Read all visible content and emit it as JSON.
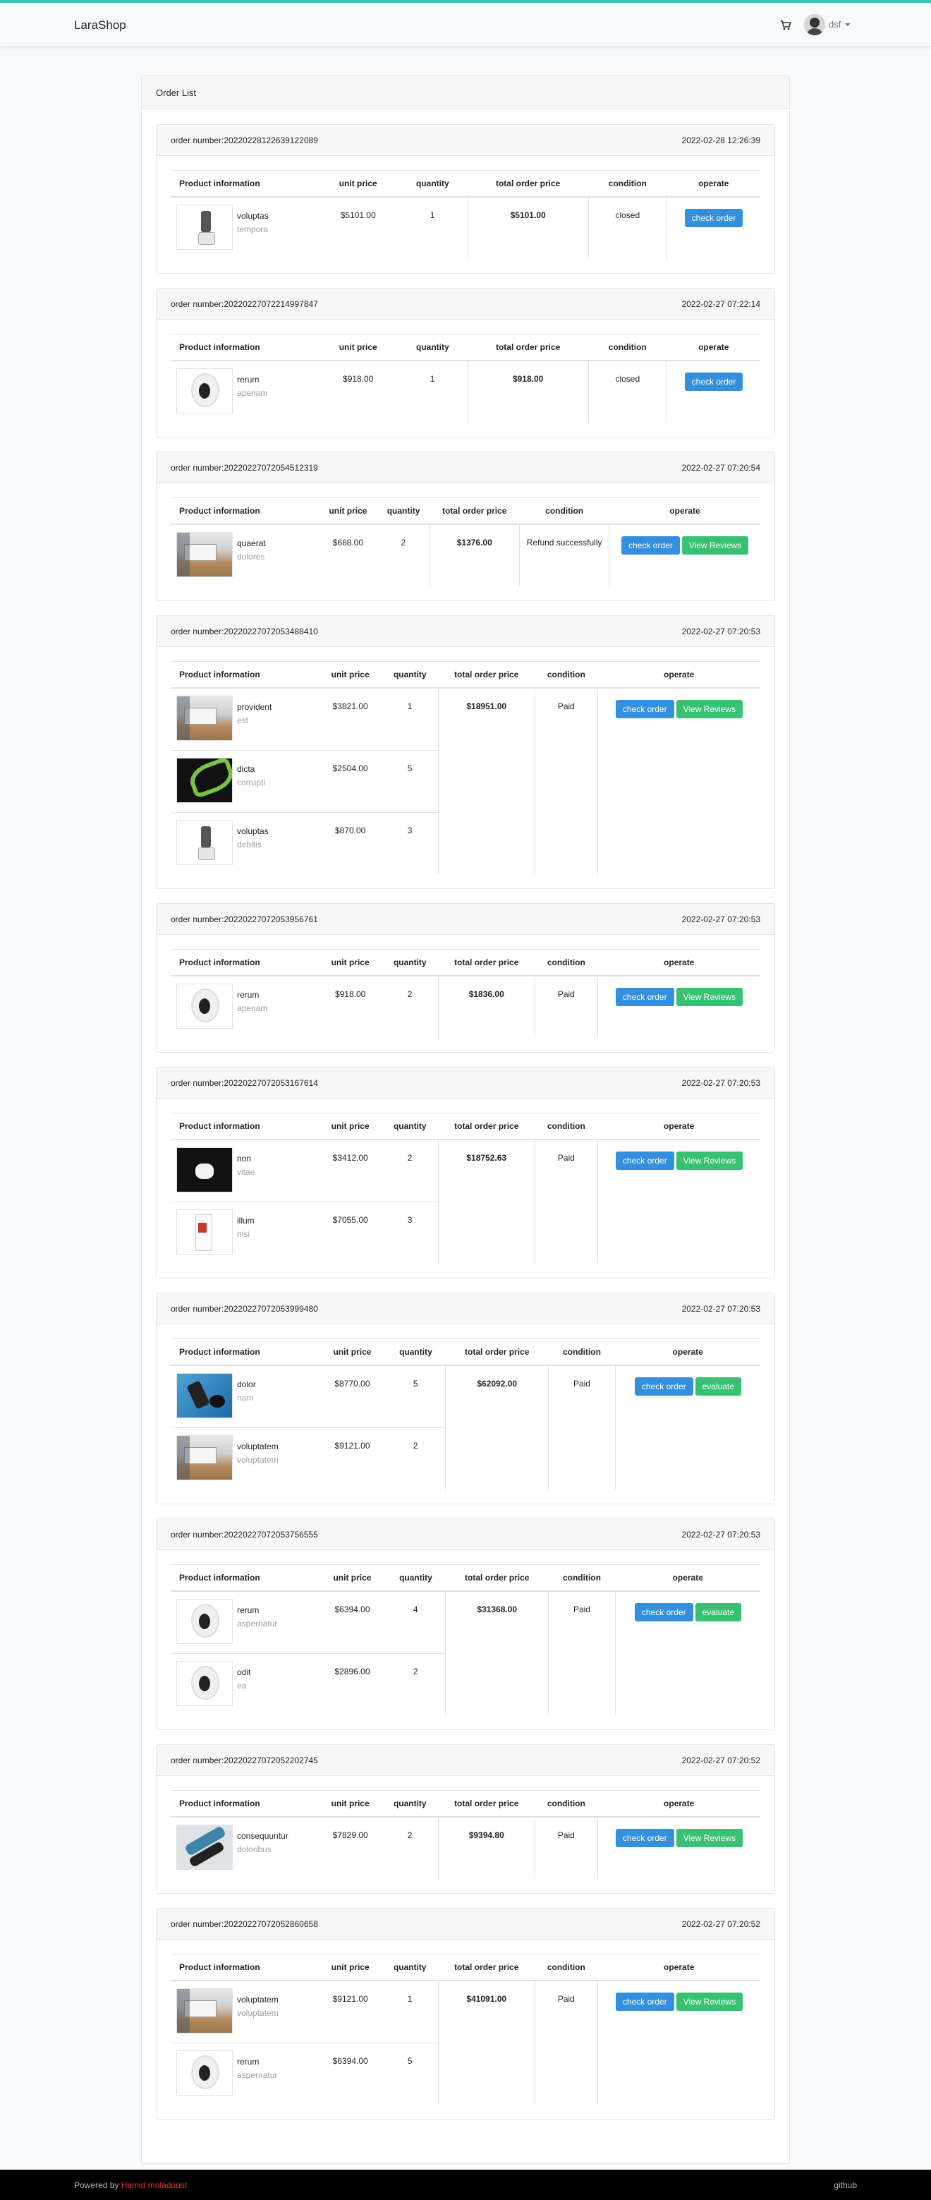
{
  "navbar": {
    "brand": "LaraShop",
    "user_name": "dsf"
  },
  "page": {
    "title": "Order List"
  },
  "columns": {
    "product": "Product information",
    "unit_price": "unit price",
    "quantity": "quantity",
    "total": "total order price",
    "condition": "condition",
    "operate": "operate"
  },
  "buttons": {
    "check": "check order",
    "reviews": "View Reviews",
    "evaluate": "evaluate"
  },
  "orders": [
    {
      "number": "order number:20220228122639122089",
      "date": "2022-02-28 12:26:39",
      "total": "$5101.00",
      "condition": "closed",
      "actions": [
        "check"
      ],
      "items": [
        {
          "name": "voluptas",
          "sub": "tempora",
          "price": "$5101.00",
          "qty": "1",
          "thumb": "camera"
        }
      ]
    },
    {
      "number": "order number:20220227072214997847",
      "date": "2022-02-27 07:22:14",
      "total": "$918.00",
      "condition": "closed",
      "actions": [
        "check"
      ],
      "items": [
        {
          "name": "rerum",
          "sub": "aperiam",
          "price": "$918.00",
          "qty": "1",
          "thumb": "ball"
        }
      ]
    },
    {
      "number": "order number:20220227072054512319",
      "date": "2022-02-27 07:20:54",
      "total": "$1376.00",
      "condition": "Refund successfully",
      "actions": [
        "check",
        "reviews"
      ],
      "items": [
        {
          "name": "quaerat",
          "sub": "dolores",
          "price": "$688.00",
          "qty": "2",
          "thumb": "box"
        }
      ]
    },
    {
      "number": "order number:20220227072053488410",
      "date": "2022-02-27 07:20:53",
      "total": "$18951.00",
      "condition": "Paid",
      "actions": [
        "check",
        "reviews"
      ],
      "items": [
        {
          "name": "provident",
          "sub": "est",
          "price": "$3821.00",
          "qty": "1",
          "thumb": "box"
        },
        {
          "name": "dicta",
          "sub": "corrupti",
          "price": "$2504.00",
          "qty": "5",
          "thumb": "green"
        },
        {
          "name": "voluptas",
          "sub": "debitis",
          "price": "$870.00",
          "qty": "3",
          "thumb": "camera"
        }
      ]
    },
    {
      "number": "order number:20220227072053956761",
      "date": "2022-02-27 07:20:53",
      "total": "$1836.00",
      "condition": "Paid",
      "actions": [
        "check",
        "reviews"
      ],
      "items": [
        {
          "name": "rerum",
          "sub": "aperiam",
          "price": "$918.00",
          "qty": "2",
          "thumb": "ball"
        }
      ]
    },
    {
      "number": "order number:20220227072053167614",
      "date": "2022-02-27 07:20:53",
      "total": "$18752.63",
      "condition": "Paid",
      "actions": [
        "check",
        "reviews"
      ],
      "items": [
        {
          "name": "non",
          "sub": "vitae",
          "price": "$3412.00",
          "qty": "2",
          "thumb": "dark"
        },
        {
          "name": "illum",
          "sub": "nisi",
          "price": "$7055.00",
          "qty": "3",
          "thumb": "label"
        }
      ]
    },
    {
      "number": "order number:20220227072053999480",
      "date": "2022-02-27 07:20:53",
      "total": "$62092.00",
      "condition": "Paid",
      "actions": [
        "check",
        "evaluate"
      ],
      "items": [
        {
          "name": "dolor",
          "sub": "nam",
          "price": "$8770.00",
          "qty": "5",
          "thumb": "blue"
        },
        {
          "name": "voluptatem",
          "sub": "voluptatem",
          "price": "$9121.00",
          "qty": "2",
          "thumb": "box"
        }
      ]
    },
    {
      "number": "order number:20220227072053756555",
      "date": "2022-02-27 07:20:53",
      "total": "$31368.00",
      "condition": "Paid",
      "actions": [
        "check",
        "evaluate"
      ],
      "items": [
        {
          "name": "rerum",
          "sub": "aspernatur",
          "price": "$6394.00",
          "qty": "4",
          "thumb": "ball"
        },
        {
          "name": "odit",
          "sub": "ea",
          "price": "$2896.00",
          "qty": "2",
          "thumb": "ball"
        }
      ]
    },
    {
      "number": "order number:20220227072052202745",
      "date": "2022-02-27 07:20:52",
      "total": "$9394.80",
      "condition": "Paid",
      "actions": [
        "check",
        "reviews"
      ],
      "items": [
        {
          "name": "consequuntur",
          "sub": "doloribus",
          "price": "$7829.00",
          "qty": "2",
          "thumb": "phone"
        }
      ]
    },
    {
      "number": "order number:20220227072052860658",
      "date": "2022-02-27 07:20:52",
      "total": "$41091.00",
      "condition": "Paid",
      "actions": [
        "check",
        "reviews"
      ],
      "items": [
        {
          "name": "voluptatem",
          "sub": "voluptatem",
          "price": "$9121.00",
          "qty": "1",
          "thumb": "box"
        },
        {
          "name": "rerum",
          "sub": "aspernatur",
          "price": "$6394.00",
          "qty": "5",
          "thumb": "ball"
        }
      ]
    }
  ],
  "footer": {
    "powered_by": "Powered by",
    "author": "Hamid moladoust",
    "github": "github"
  },
  "colors": {
    "accent": "#3bc7b8",
    "primary": "#3490dc",
    "success": "#38c172",
    "link": "#e3342f"
  },
  "icons": {
    "cart": "cart-icon",
    "avatar": "avatar-icon",
    "caret": "caret-down-icon"
  }
}
